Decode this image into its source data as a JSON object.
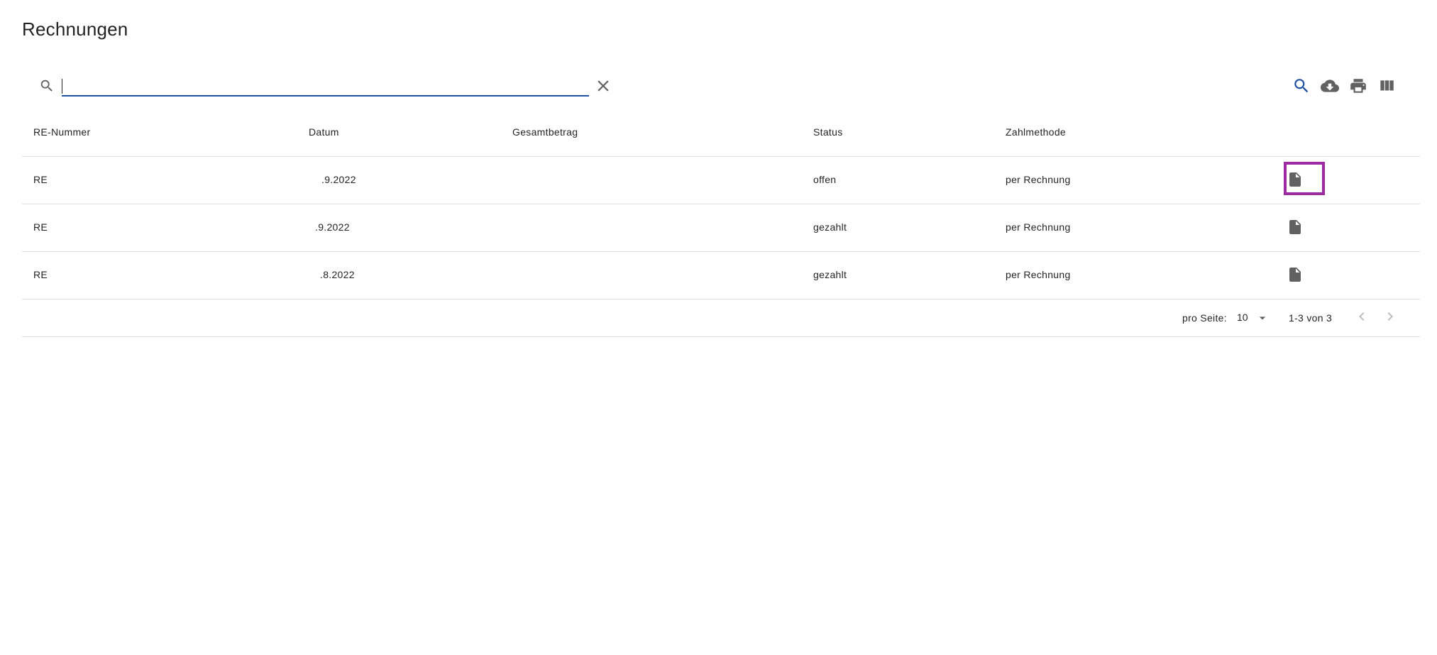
{
  "page": {
    "title": "Rechnungen"
  },
  "search": {
    "value": "",
    "placeholder": ""
  },
  "toolbar": {
    "icons": [
      "search-icon",
      "cloud-download-icon",
      "print-icon",
      "view-column-icon"
    ],
    "clear_icon": "close-icon"
  },
  "table": {
    "columns": [
      "RE-Nummer",
      "Datum",
      "Gesamtbetrag",
      "Status",
      "Zahlmethode",
      ""
    ],
    "rows": [
      {
        "re_nummer": "RE",
        "datum": ".9.2022",
        "gesamtbetrag": "",
        "status": "offen",
        "zahlmethode": "per Rechnung",
        "action_icon": "file-icon"
      },
      {
        "re_nummer": "RE",
        "datum": ".9.2022",
        "gesamtbetrag": "",
        "status": "gezahlt",
        "zahlmethode": "per Rechnung",
        "action_icon": "file-icon"
      },
      {
        "re_nummer": "RE",
        "datum": ".8.2022",
        "gesamtbetrag": "",
        "status": "gezahlt",
        "zahlmethode": "per Rechnung",
        "action_icon": "file-icon"
      }
    ]
  },
  "pagination": {
    "per_page_label": "pro Seite:",
    "per_page_value": "10",
    "range": "1-3 von 3"
  },
  "colors": {
    "accent": "#1f4fa0",
    "highlight": "#9b2aa3",
    "icon": "#616161",
    "divider": "#e0e0e0"
  }
}
